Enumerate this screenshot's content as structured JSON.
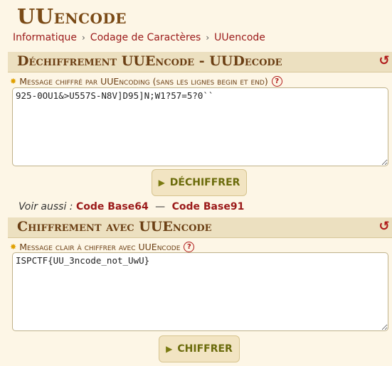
{
  "page": {
    "title": "UUencode"
  },
  "breadcrumb": {
    "items": [
      "Informatique",
      "Codage de Caractères",
      "UUencode"
    ],
    "separator": "›"
  },
  "decode": {
    "title": "Déchiffrement UUEncode - UUDecode",
    "label": "Message chiffré par UUEncoding (sans les lignes begin et end)",
    "value": "925-0OU1&>U557S-N8V]D95]N;W1?57=5?0``",
    "button": "DÉCHIFFRER"
  },
  "see_also": {
    "lead": "Voir aussi :",
    "links": [
      "Code Base64",
      "Code Base91"
    ],
    "dash": "—"
  },
  "encode": {
    "title": "Chiffrement avec UUEncode",
    "label": "Message clair à chiffrer avec UUEncode",
    "value": "ISPCTF{UU_3ncode_not_UwU}",
    "button": "CHIFFRER"
  },
  "icons": {
    "reset": "reset-icon",
    "help": "help-icon",
    "star": "star-icon",
    "play": "play-icon"
  },
  "colors": {
    "accent": "#9b1a1a",
    "header_bg": "#ece0c0",
    "page_bg": "#fdf6e6",
    "title": "#7a4a16"
  }
}
